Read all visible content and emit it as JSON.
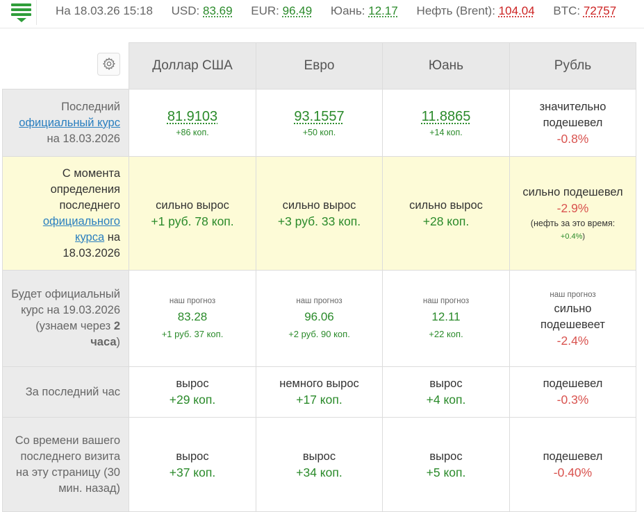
{
  "ticker": {
    "date_prefix": "На 18.03.26 15:18",
    "usd_label": "USD:",
    "usd_value": "83.69",
    "eur_label": "EUR:",
    "eur_value": "96.49",
    "cny_label": "Юань:",
    "cny_value": "12.17",
    "oil_label": "Нефть (Brent):",
    "oil_value": "104.04",
    "btc_label": "BTC:",
    "btc_value": "72757"
  },
  "columns": [
    "Доллар США",
    "Евро",
    "Юань",
    "Рубль"
  ],
  "row_official": {
    "label_1": "Последний",
    "label_link": "официальный курс",
    "label_2": "на 18.03.2026",
    "usd": {
      "rate": "81.9103",
      "change": "+86 коп."
    },
    "eur": {
      "rate": "93.1557",
      "change": "+50 коп."
    },
    "cny": {
      "rate": "11.8865",
      "change": "+14 коп."
    },
    "rub": {
      "word_1": "значительно",
      "word_2": "подешевел",
      "pct": "-0.8%"
    }
  },
  "row_since": {
    "label_1": "С момента определения последнего",
    "label_link_1": "официального",
    "label_link_2": "курса",
    "label_2": " на",
    "label_3": "18.03.2026",
    "usd": {
      "word": "сильно вырос",
      "delta": "+1 руб. 78 коп."
    },
    "eur": {
      "word": "сильно вырос",
      "delta": "+3 руб. 33 коп."
    },
    "cny": {
      "word": "сильно вырос",
      "delta": "+28 коп."
    },
    "rub": {
      "word": "сильно подешевел",
      "pct": "-2.9%",
      "oil_note": "(нефть за это время:",
      "oil_value": "+0.4%",
      "oil_close": ")"
    }
  },
  "row_forecast": {
    "label_1": "Будет официальный курс на 19.03.2026 (узнаем через ",
    "label_bold_1": "2",
    "label_bold_2": "часа",
    "label_close": ")",
    "note": "наш прогноз",
    "usd": {
      "value": "83.28",
      "delta": "+1 руб. 37 коп."
    },
    "eur": {
      "value": "96.06",
      "delta": "+2 руб. 90 коп."
    },
    "cny": {
      "value": "12.11",
      "delta": "+22 коп."
    },
    "rub": {
      "word_1": "сильно",
      "word_2": "подешевеет",
      "pct": "-2.4%"
    }
  },
  "row_hour": {
    "label": "За последний час",
    "usd": {
      "word": "вырос",
      "delta": "+29 коп."
    },
    "eur": {
      "word": "немного вырос",
      "delta": "+17 коп."
    },
    "cny": {
      "word": "вырос",
      "delta": "+4 коп."
    },
    "rub": {
      "word": "подешевел",
      "pct": "-0.3%"
    }
  },
  "row_visit": {
    "label": "Со времени вашего последнего визита на эту страницу (30 мин. назад)",
    "usd": {
      "word": "вырос",
      "delta": "+37 коп."
    },
    "eur": {
      "word": "вырос",
      "delta": "+34 коп."
    },
    "cny": {
      "word": "вырос",
      "delta": "+5 коп."
    },
    "rub": {
      "word": "подешевел",
      "pct": "-0.40%"
    }
  },
  "colors": {
    "green": "#2a8a2a",
    "red": "#d9534f",
    "highlight": "#fdfbd7",
    "header_bg": "#e9e9e9"
  },
  "icons": {
    "menu": "hamburger-menu-icon",
    "settings": "gear-icon"
  }
}
